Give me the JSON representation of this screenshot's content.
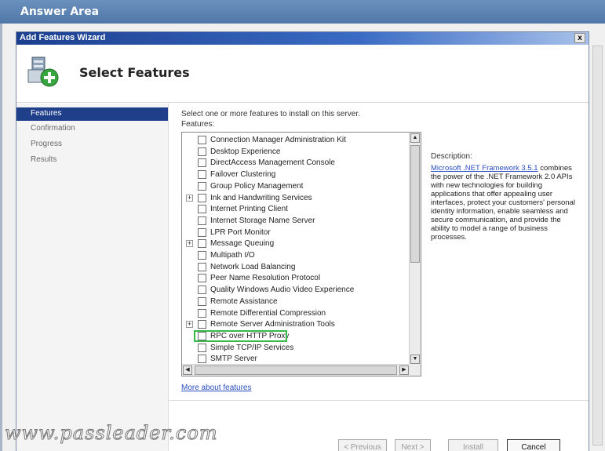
{
  "answer_area": {
    "title": "Answer Area"
  },
  "window": {
    "title": "Add Features Wizard",
    "close": "x"
  },
  "header": {
    "page_title": "Select Features"
  },
  "nav": {
    "items": [
      {
        "label": "Features",
        "active": true
      },
      {
        "label": "Confirmation",
        "active": false
      },
      {
        "label": "Progress",
        "active": false
      },
      {
        "label": "Results",
        "active": false
      }
    ]
  },
  "main": {
    "instruction": "Select one or more features to install on this server.",
    "features_label": "Features:",
    "features": [
      {
        "label": "Connection Manager Administration Kit",
        "expander": false,
        "checked": false
      },
      {
        "label": "Desktop Experience",
        "expander": false,
        "checked": false
      },
      {
        "label": "DirectAccess Management Console",
        "expander": false,
        "checked": false
      },
      {
        "label": "Failover Clustering",
        "expander": false,
        "checked": false
      },
      {
        "label": "Group Policy Management",
        "expander": false,
        "checked": false
      },
      {
        "label": "Ink and Handwriting Services",
        "expander": true,
        "checked": false
      },
      {
        "label": "Internet Printing Client",
        "expander": false,
        "checked": false
      },
      {
        "label": "Internet Storage Name Server",
        "expander": false,
        "checked": false
      },
      {
        "label": "LPR Port Monitor",
        "expander": false,
        "checked": false
      },
      {
        "label": "Message Queuing",
        "expander": true,
        "checked": false
      },
      {
        "label": "Multipath I/O",
        "expander": false,
        "checked": false
      },
      {
        "label": "Network Load Balancing",
        "expander": false,
        "checked": false
      },
      {
        "label": "Peer Name Resolution Protocol",
        "expander": false,
        "checked": false
      },
      {
        "label": "Quality Windows Audio Video Experience",
        "expander": false,
        "checked": false
      },
      {
        "label": "Remote Assistance",
        "expander": false,
        "checked": false
      },
      {
        "label": "Remote Differential Compression",
        "expander": false,
        "checked": false
      },
      {
        "label": "Remote Server Administration Tools",
        "expander": true,
        "checked": false
      },
      {
        "label": "RPC over HTTP Proxy",
        "expander": false,
        "checked": false,
        "highlighted": true
      },
      {
        "label": "Simple TCP/IP Services",
        "expander": false,
        "checked": false
      },
      {
        "label": "SMTP Server",
        "expander": false,
        "checked": false
      }
    ],
    "description_label": "Description:",
    "description_link": "Microsoft .NET Framework 3.5.1",
    "description_text": "combines the power of the .NET Framework 2.0 APIs with new technologies for building applications that offer appealing user interfaces, protect your customers' personal identity information, enable seamless and secure communication, and provide the ability to model a range of business processes.",
    "more_link": "More about features"
  },
  "buttons": {
    "previous": "< Previous",
    "next": "Next >",
    "install": "Install",
    "cancel": "Cancel"
  },
  "watermark": "www.passleader.com",
  "colors": {
    "highlight": "#39b84a",
    "nav_active": "#1f3f8a",
    "title_bar": "#1c3f8f",
    "link": "#2a4fc0"
  }
}
